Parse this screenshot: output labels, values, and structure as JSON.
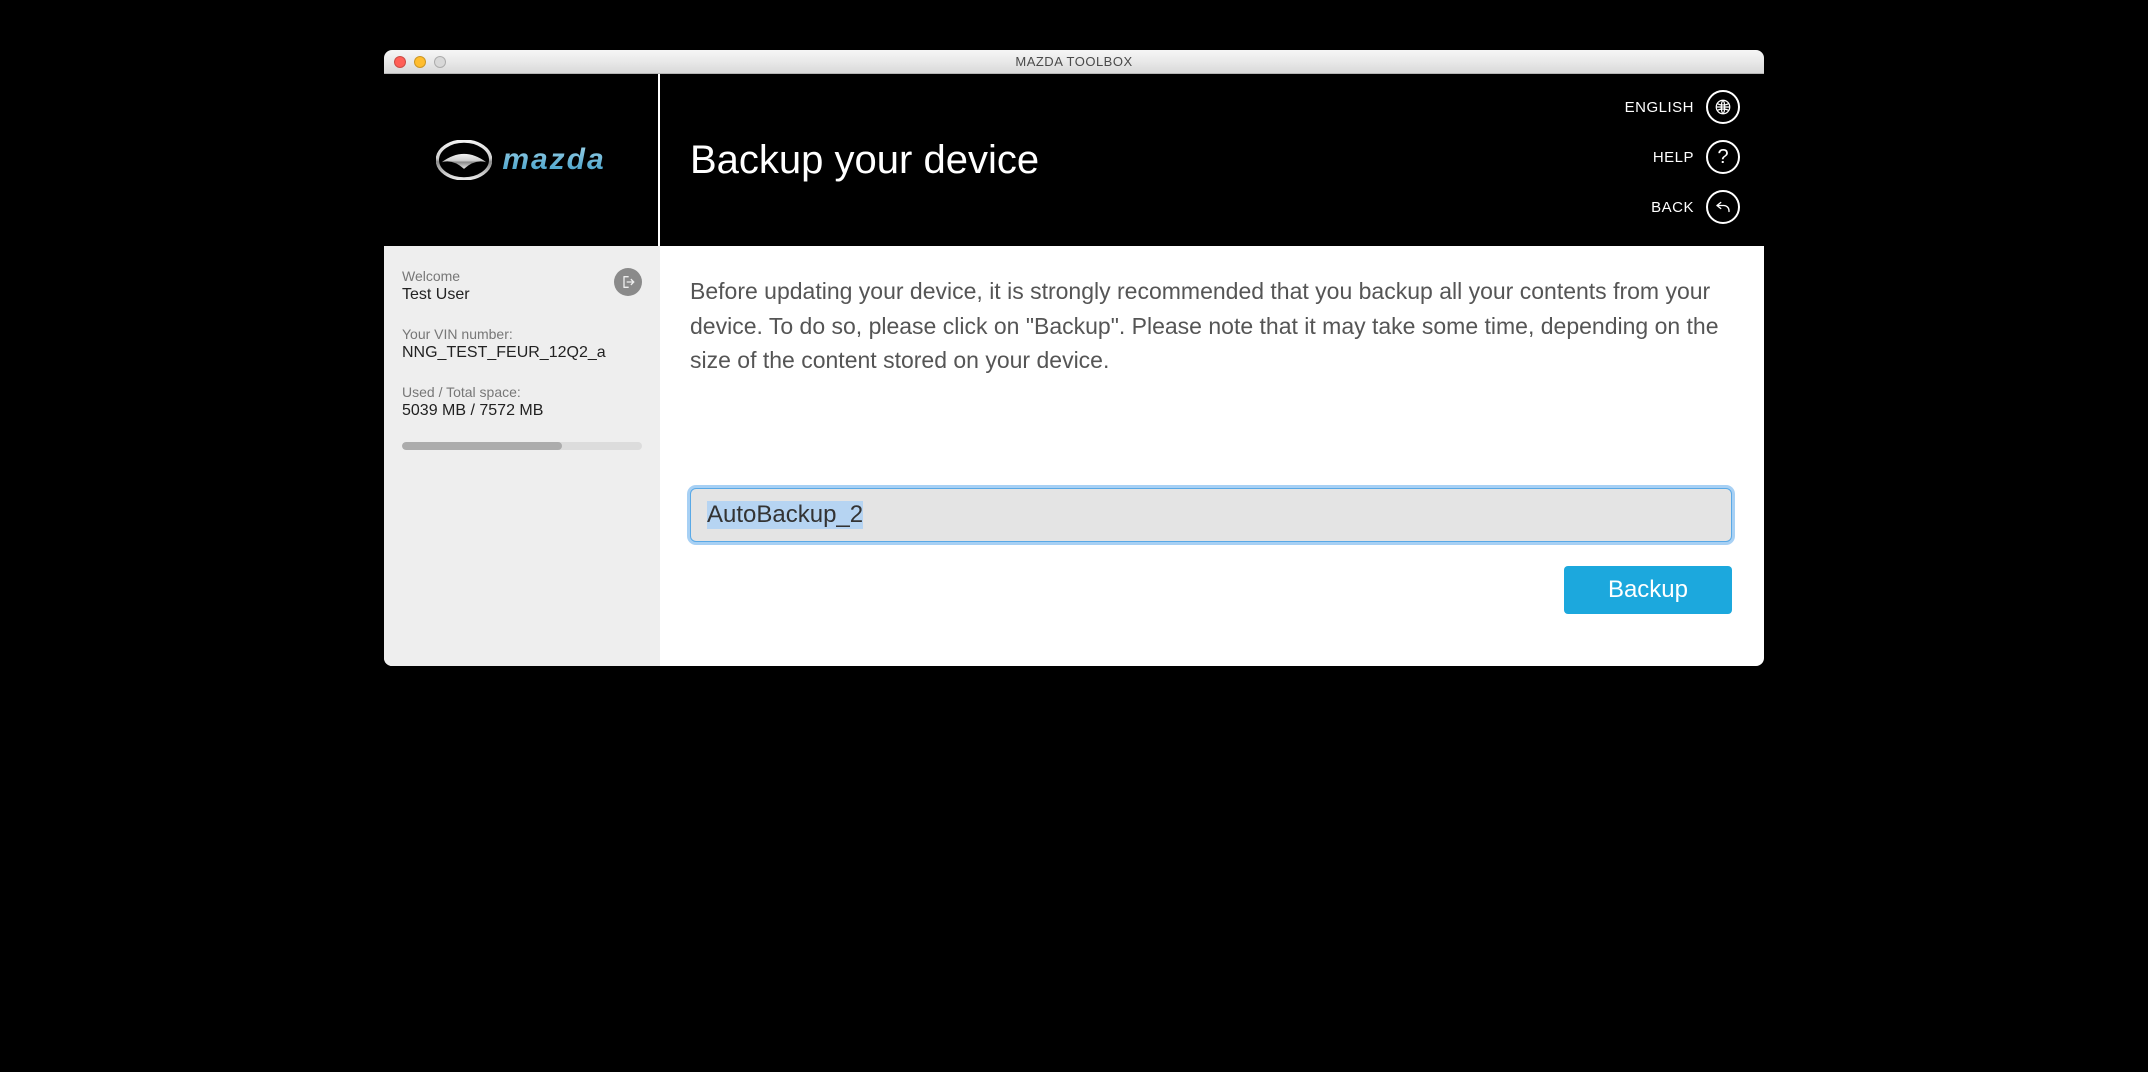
{
  "window": {
    "title": "MAZDA TOOLBOX"
  },
  "brand": {
    "name": "mazda"
  },
  "header": {
    "page_title": "Backup your device",
    "nav": {
      "language_label": "ENGLISH",
      "help_label": "HELP",
      "back_label": "BACK"
    }
  },
  "sidebar": {
    "welcome_label": "Welcome",
    "user_name": "Test User",
    "vin_label": "Your VIN number:",
    "vin_value": "NNG_TEST_FEUR_12Q2_a",
    "space_label": "Used / Total space:",
    "space_value": "5039 MB / 7572 MB",
    "space_used": 5039,
    "space_total": 7572
  },
  "main": {
    "instructions": "Before updating your device, it is strongly recommended that you backup all your contents from your device. To do so, please click on \"Backup\". Please note that it may take some time, depending on the size of the content stored on your device.",
    "backup_name_value": "AutoBackup_2",
    "backup_button_label": "Backup"
  },
  "colors": {
    "accent": "#1ca8dd"
  }
}
